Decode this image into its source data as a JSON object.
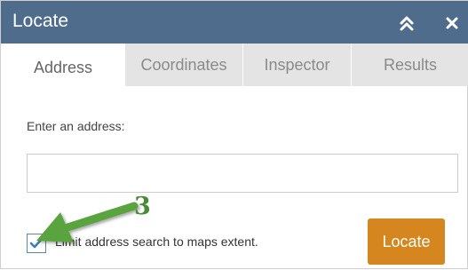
{
  "window": {
    "title": "Locate",
    "header_color": "#4f6c8d"
  },
  "tabs": [
    {
      "label": "Address",
      "active": true
    },
    {
      "label": "Coordinates",
      "active": false
    },
    {
      "label": "Inspector",
      "active": false
    },
    {
      "label": "Results",
      "active": false
    }
  ],
  "address": {
    "prompt": "Enter an address:",
    "value": "",
    "placeholder": ""
  },
  "options": {
    "limit_extent_label": "Limit address search to maps extent.",
    "limit_extent_checked": true
  },
  "actions": {
    "locate_label": "Locate",
    "locate_color": "#d6861e"
  },
  "annotation": {
    "step_number": "3",
    "arrow_color": "#5aa43f"
  },
  "icons": {
    "collapse": "double-chevron-up-icon",
    "close": "close-icon",
    "check": "checkmark-icon"
  }
}
